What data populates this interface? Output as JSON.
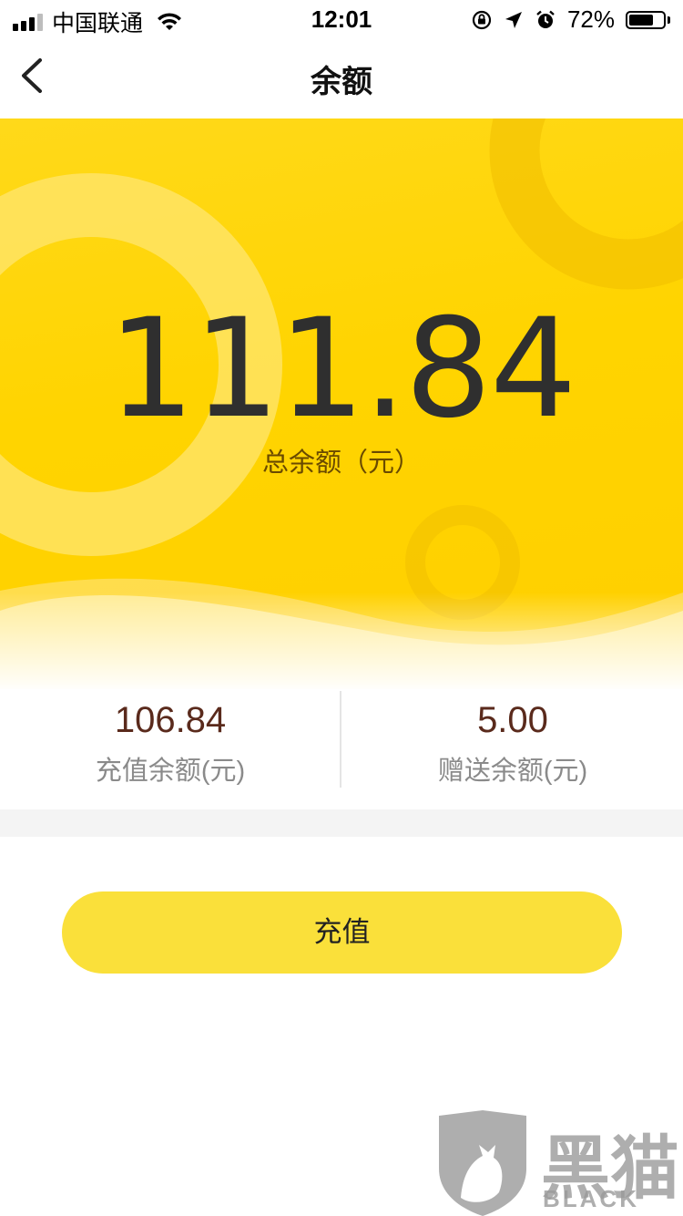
{
  "status_bar": {
    "carrier": "中国联通",
    "time": "12:01",
    "battery_percent": "72%",
    "battery_level": 0.72,
    "icons": [
      "signal-icon",
      "wifi-icon",
      "orientation-lock-icon",
      "location-icon",
      "alarm-icon",
      "battery-icon"
    ]
  },
  "nav": {
    "title": "余额",
    "back_icon": "chevron-left-icon"
  },
  "balance": {
    "total": "111.84",
    "total_label": "总余额（元）",
    "recharge_amount": "106.84",
    "recharge_label": "充值余额(元)",
    "bonus_amount": "5.00",
    "bonus_label": "赠送余额(元)"
  },
  "actions": {
    "recharge_button": "充值"
  },
  "watermark": {
    "cn": "黑猫",
    "en": "BLACK CAT"
  },
  "colors": {
    "hero_yellow": "#ffd400",
    "button_yellow": "#fae03a",
    "amount_brown": "#5a2a1c",
    "label_gray": "#8a8a8a"
  }
}
